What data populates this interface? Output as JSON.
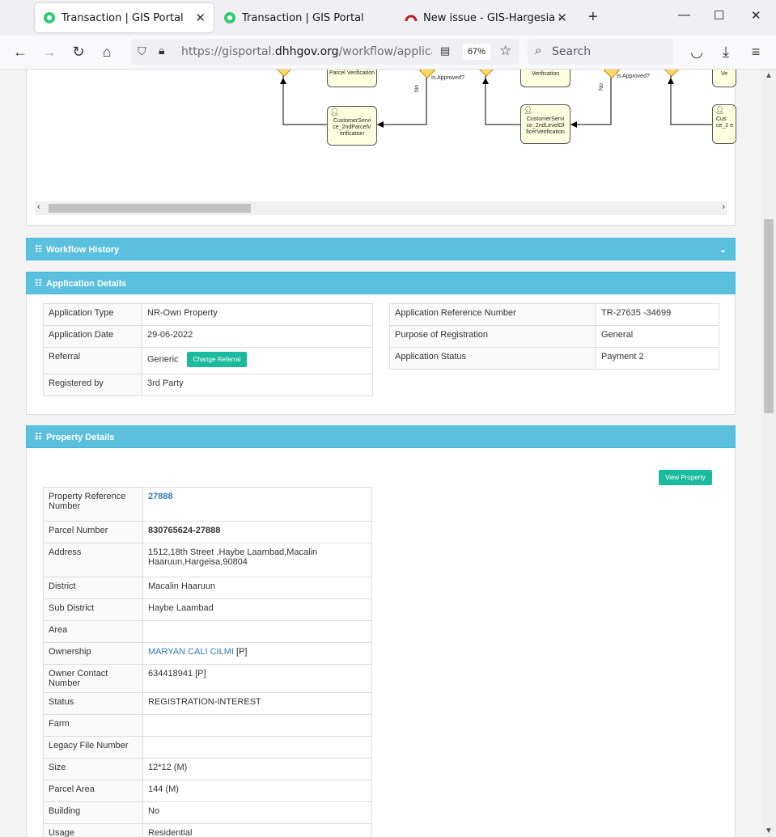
{
  "browser": {
    "tabs": [
      {
        "title": "Transaction | GIS Portal",
        "active": true
      },
      {
        "title": "Transaction | GIS Portal",
        "active": false
      },
      {
        "title": "New issue - GIS-Hargesia - Team",
        "active": false
      }
    ],
    "url_prefix": "https://gisportal.",
    "url_domain": "dhhgov.org",
    "url_path": "/workflow/application/",
    "zoom": "67%",
    "search_placeholder": "Search"
  },
  "diagram": {
    "nodes": [
      {
        "label": "Parcel Verification"
      },
      {
        "label": "CustomerServi ce_2ndParcelV erification"
      },
      {
        "label": "Verification"
      },
      {
        "label": "CustomerServi ce_2ndLevelOf ficerVerification"
      },
      {
        "label": "Ve"
      },
      {
        "label": "Cus ce_2 e"
      }
    ],
    "gateway_labels": [
      "Is Approved?",
      "Is Approved?"
    ],
    "edge_labels": [
      "No",
      "No"
    ]
  },
  "workflow_history": {
    "title": "Workflow History"
  },
  "application_details": {
    "title": "Application Details",
    "left": [
      {
        "key": "Application Type",
        "value": "NR-Own Property"
      },
      {
        "key": "Application Date",
        "value": "29-06-2022"
      },
      {
        "key": "Referral",
        "value": "Generic",
        "button": "Change Referral"
      },
      {
        "key": "Registered by",
        "value": "3rd Party"
      }
    ],
    "right": [
      {
        "key": "Application Reference Number",
        "value": "TR-27635 -34699"
      },
      {
        "key": "Purpose of Registration",
        "value": "General"
      },
      {
        "key": "Application Status",
        "value": "Payment 2"
      }
    ]
  },
  "property_details": {
    "title": "Property Details",
    "view_button": "View Property",
    "rows": [
      {
        "key": "Property Reference Number",
        "value": "27888"
      },
      {
        "key": "Parcel Number",
        "value": "830765624-27888"
      },
      {
        "key": "Address",
        "value": "1512,18th Street ,Haybe Laambad,Macalin Haaruun,Hargeisa,90804"
      },
      {
        "key": "District",
        "value": "Macalin Haaruun"
      },
      {
        "key": "Sub District",
        "value": "Haybe Laambad"
      },
      {
        "key": "Area",
        "value": ""
      },
      {
        "key": "Ownership",
        "value": "MARYAN CALI CILMI",
        "suffix": " [P]"
      },
      {
        "key": "Owner Contact Number",
        "value": "634418941 [P]"
      },
      {
        "key": "Status",
        "value": "REGISTRATION-INTEREST"
      },
      {
        "key": "Farm",
        "value": ""
      },
      {
        "key": "Legacy File Number",
        "value": ""
      },
      {
        "key": "Size",
        "value": "12*12 (M)"
      },
      {
        "key": "Parcel Area",
        "value": "144 (M)"
      },
      {
        "key": "Building",
        "value": "No"
      },
      {
        "key": "Usage",
        "value": "Residential"
      }
    ]
  }
}
